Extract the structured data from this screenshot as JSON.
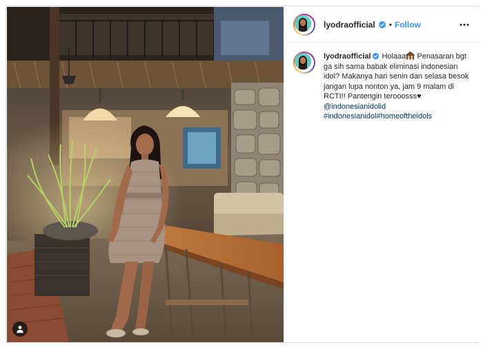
{
  "post": {
    "username": "lyodraofficial",
    "follow_label": "Follow",
    "separator": "•",
    "caption": {
      "username": "lyodraofficial",
      "text_1": "Holaaa",
      "emoji_1": "house-emoji",
      "text_2": " Penasaran bgt ga sih sama babak eliminasi indonesian idol? Makanya hari senin dan selasa besok jangan lupa nonton ya, jam 9 malam di RCTI!! Pantengin terooosss",
      "heart": "♥",
      "mention": "@indonesianidolid",
      "hashtag_1": "#indonesianidol",
      "hashtag_2": "#homeoftheidols"
    }
  },
  "icons": {
    "verified": "verified-badge-icon",
    "more": "more-options-icon",
    "user_tag": "user-tag-icon"
  },
  "colors": {
    "accent": "#3897f0",
    "link": "#00376b",
    "verified": "#3897f0",
    "text": "#262626"
  }
}
